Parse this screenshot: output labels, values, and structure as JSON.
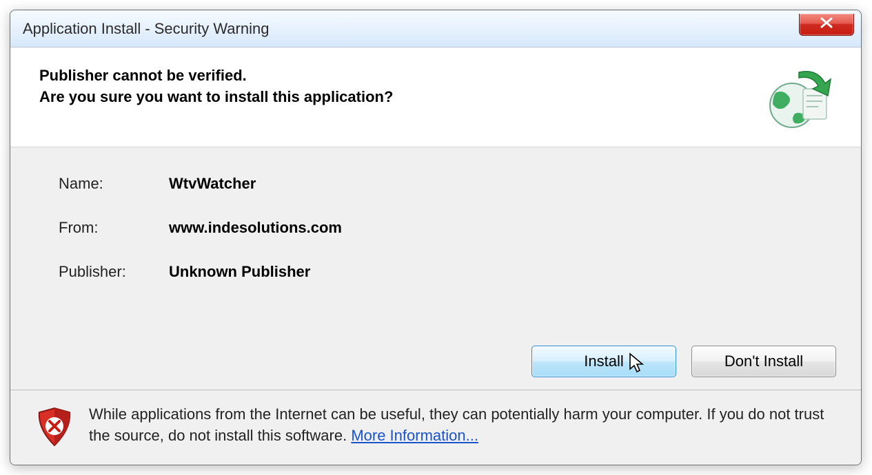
{
  "titlebar": {
    "title": "Application Install - Security Warning"
  },
  "header": {
    "line1": "Publisher cannot be verified.",
    "line2": "Are you sure you want to install this application?"
  },
  "fields": {
    "name_label": "Name:",
    "name_value": "WtvWatcher",
    "from_label": "From:",
    "from_value": "www.indesolutions.com",
    "publisher_label": "Publisher:",
    "publisher_value": "Unknown Publisher"
  },
  "buttons": {
    "install": "Install",
    "dont_install": "Don't Install"
  },
  "footer": {
    "warning_text": "While applications from the Internet can be useful, they can potentially harm your computer. If you do not trust the source, do not install this software. ",
    "more_info": "More Information..."
  }
}
